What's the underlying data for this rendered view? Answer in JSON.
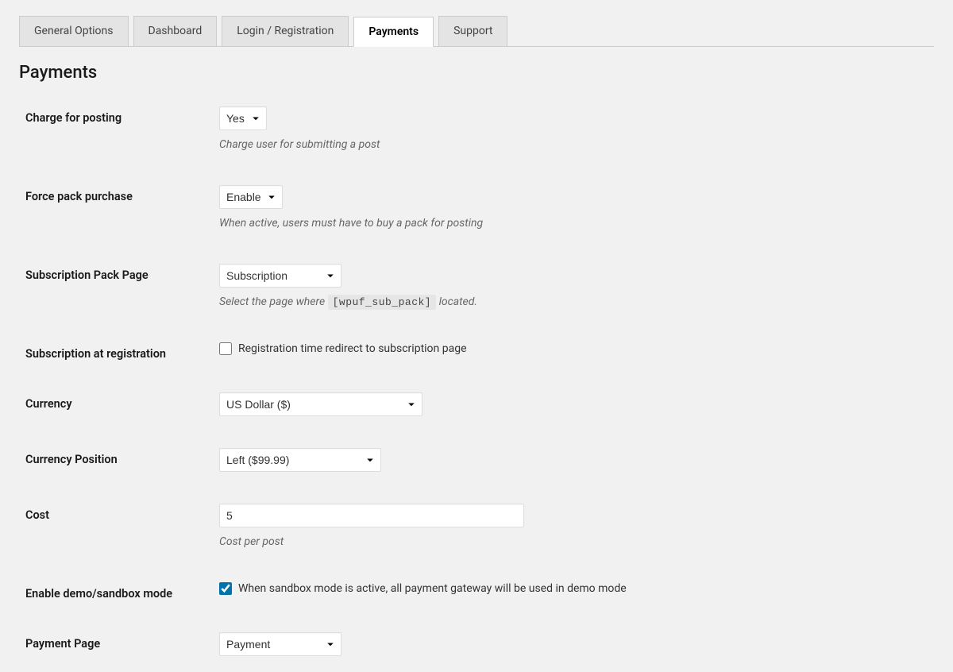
{
  "tabs": {
    "general": "General Options",
    "dashboard": "Dashboard",
    "login": "Login / Registration",
    "payments": "Payments",
    "support": "Support"
  },
  "page_title": "Payments",
  "fields": {
    "charge_posting": {
      "label": "Charge for posting",
      "value": "Yes",
      "desc": "Charge user for submitting a post"
    },
    "force_pack": {
      "label": "Force pack purchase",
      "value": "Enable",
      "desc": "When active, users must have to buy a pack for posting"
    },
    "sub_page": {
      "label": "Subscription Pack Page",
      "value": "Subscription",
      "desc_before": "Select the page where ",
      "desc_code": "[wpuf_sub_pack]",
      "desc_after": " located."
    },
    "sub_reg": {
      "label": "Subscription at registration",
      "checkbox_label": "Registration time redirect to subscription page"
    },
    "currency": {
      "label": "Currency",
      "value": "US Dollar ($)"
    },
    "currency_pos": {
      "label": "Currency Position",
      "value": "Left ($99.99)"
    },
    "cost": {
      "label": "Cost",
      "value": "5",
      "desc": "Cost per post"
    },
    "sandbox": {
      "label": "Enable demo/sandbox mode",
      "checkbox_label": "When sandbox mode is active, all payment gateway will be used in demo mode"
    },
    "payment_page": {
      "label": "Payment Page",
      "value": "Payment"
    }
  }
}
